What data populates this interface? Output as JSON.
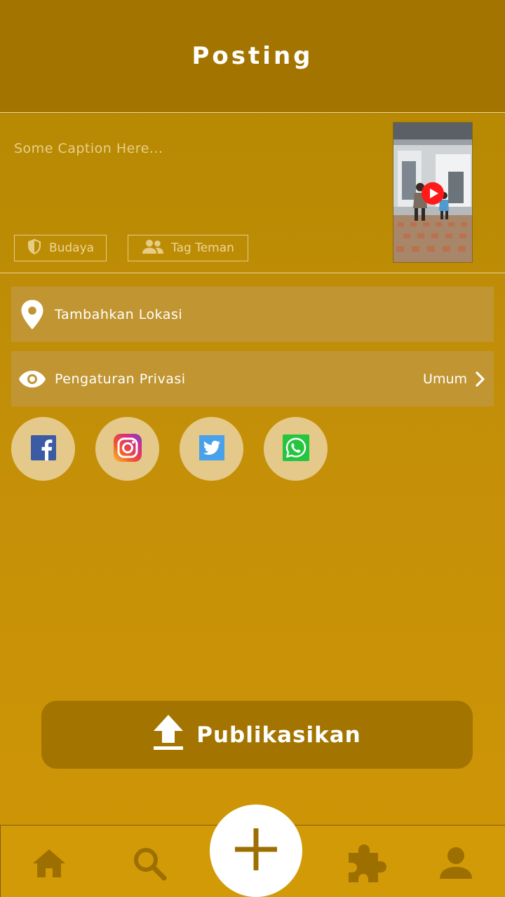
{
  "header": {
    "title": "Posting"
  },
  "compose": {
    "caption_placeholder": "Some Caption Here...",
    "chips": [
      {
        "label": "Budaya",
        "icon": "shield-icon"
      },
      {
        "label": "Tag Teman",
        "icon": "people-icon"
      }
    ],
    "thumbnail": {
      "icon": "play-icon"
    }
  },
  "options": {
    "location": {
      "label": "Tambahkan Lokasi",
      "icon": "location-pin-icon"
    },
    "privacy": {
      "label": "Pengaturan Privasi",
      "value": "Umum",
      "icon": "eye-icon"
    }
  },
  "share": [
    "facebook-icon",
    "instagram-icon",
    "twitter-icon",
    "whatsapp-icon"
  ],
  "publish": {
    "label": "Publikasikan",
    "icon": "upload-icon"
  },
  "bottom_nav": [
    "home-icon",
    "search-icon",
    "add-icon",
    "puzzle-icon",
    "profile-icon"
  ],
  "colors": {
    "header": "#a37500",
    "background": "#c38f08",
    "row": "#c19632",
    "share_circle": "#e5c98a",
    "nav_icon": "#9d6f00"
  }
}
